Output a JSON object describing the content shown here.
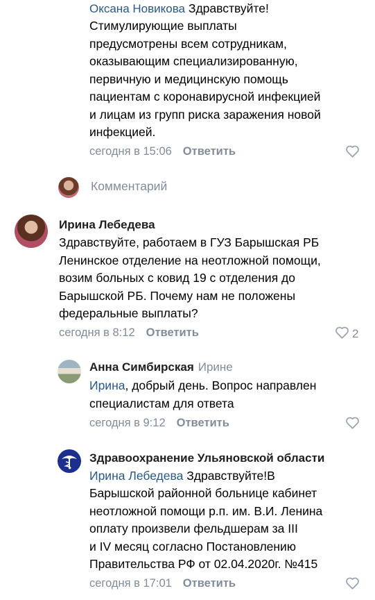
{
  "comments": [
    {
      "author": "Оксана Новикова",
      "text": "Здравствуйте!\nСтимулирующие выплаты\nпредусмотрены всем сотрудникам,\nоказывающим специализированную,\nпервичную и медицинскую помощь\nпациентам с коронавирусной инфекцией\nи лицам из групп риска заражения новой\nинфекцией.",
      "time": "сегодня в 15:06",
      "reply_label": "Ответить"
    },
    {
      "author": "Ирина Лебедева",
      "text": "Здравствуйте, работаем в ГУЗ Барышская РБ\nЛенинское отделение на неотложной помощи,\nвозим больных с ковид 19 с отделения до\nБарышской РБ. Почему нам не положены\nфедеральные выплаты?",
      "time": "сегодня в 8:12",
      "reply_label": "Ответить",
      "like_count": "2"
    },
    {
      "author": "Анна Симбирская",
      "reply_to": "Ирине",
      "mention": "Ирина",
      "text": ", добрый день. Вопрос направлен\nспециалистам для ответа",
      "time": "сегодня в 9:12",
      "reply_label": "Ответить"
    },
    {
      "author": "Здравоохранение  Ульяновской области",
      "mention": "Ирина Лебедева",
      "text_first": " Здравствуйте!В",
      "text": "Барышской районной больнице кабинет\nнеотложной помощи р.п. им. В.И. Ленина\nоплату произвели фельдшерам за III\nи IV месяц согласно Постановлению\nПравительства РФ от 02.04.2020г. №415",
      "time": "сегодня в 17:01",
      "reply_label": "Ответить"
    }
  ],
  "comment_input": {
    "placeholder": "Комментарий"
  },
  "colors": {
    "link": "#2a5885",
    "meta": "#818c99",
    "text": "#000000"
  }
}
